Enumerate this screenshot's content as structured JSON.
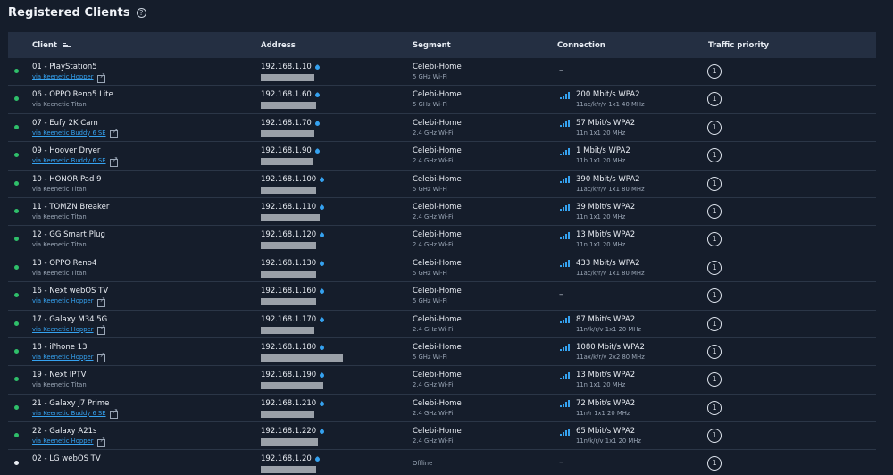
{
  "page": {
    "title": "Registered Clients",
    "help_icon": "?"
  },
  "columns": {
    "client": "Client",
    "address": "Address",
    "segment": "Segment",
    "connection": "Connection",
    "traffic_priority": "Traffic priority"
  },
  "clients": [
    {
      "status": "online",
      "name": "01 - PlayStation5",
      "via": "via Keenetic Hopper",
      "via_link": true,
      "ip": "192.168.1.10",
      "mac_width": 60,
      "segment": "Celebi-Home",
      "band": "5 GHz Wi-Fi",
      "connection": "",
      "conn_detail": "",
      "signal_bars": 0,
      "priority": "1",
      "dash": "–"
    },
    {
      "status": "online",
      "name": "06 - OPPO Reno5 Lite",
      "via": "via Keenetic Titan",
      "via_link": false,
      "ip": "192.168.1.60",
      "mac_width": 62,
      "segment": "Celebi-Home",
      "band": "5 GHz Wi-Fi",
      "connection": "200 Mbit/s  WPA2",
      "conn_detail": "11ac/k/r/v 1x1 40 MHz",
      "signal_bars": 4,
      "priority": "1",
      "dash": ""
    },
    {
      "status": "online",
      "name": "07 - Eufy 2K Cam",
      "via": "via Keenetic Buddy 6 SE",
      "via_link": true,
      "ip": "192.168.1.70",
      "mac_width": 60,
      "segment": "Celebi-Home",
      "band": "2.4 GHz Wi-Fi",
      "connection": "57 Mbit/s  WPA2",
      "conn_detail": "11n 1x1 20 MHz",
      "signal_bars": 4,
      "priority": "1",
      "dash": ""
    },
    {
      "status": "online",
      "name": "09 - Hoover Dryer",
      "via": "via Keenetic Buddy 6 SE",
      "via_link": true,
      "ip": "192.168.1.90",
      "mac_width": 58,
      "segment": "Celebi-Home",
      "band": "2.4 GHz Wi-Fi",
      "connection": "1 Mbit/s  WPA2",
      "conn_detail": "11b 1x1 20 MHz",
      "signal_bars": 4,
      "priority": "1",
      "dash": ""
    },
    {
      "status": "online",
      "name": "10 - HONOR Pad 9",
      "via": "via Keenetic Titan",
      "via_link": false,
      "ip": "192.168.1.100",
      "mac_width": 62,
      "segment": "Celebi-Home",
      "band": "5 GHz Wi-Fi",
      "connection": "390 Mbit/s  WPA2",
      "conn_detail": "11ac/k/r/v 1x1 80 MHz",
      "signal_bars": 4,
      "priority": "1",
      "dash": ""
    },
    {
      "status": "online",
      "name": "11 - TOMZN Breaker",
      "via": "via Keenetic Titan",
      "via_link": false,
      "ip": "192.168.1.110",
      "mac_width": 66,
      "segment": "Celebi-Home",
      "band": "2.4 GHz Wi-Fi",
      "connection": "39 Mbit/s  WPA2",
      "conn_detail": "11n 1x1 20 MHz",
      "signal_bars": 4,
      "priority": "1",
      "dash": ""
    },
    {
      "status": "online",
      "name": "12 - GG Smart Plug",
      "via": "via Keenetic Titan",
      "via_link": false,
      "ip": "192.168.1.120",
      "mac_width": 62,
      "segment": "Celebi-Home",
      "band": "2.4 GHz Wi-Fi",
      "connection": "13 Mbit/s  WPA2",
      "conn_detail": "11n 1x1 20 MHz",
      "signal_bars": 4,
      "priority": "1",
      "dash": ""
    },
    {
      "status": "online",
      "name": "13 - OPPO Reno4",
      "via": "via Keenetic Titan",
      "via_link": false,
      "ip": "192.168.1.130",
      "mac_width": 62,
      "segment": "Celebi-Home",
      "band": "5 GHz Wi-Fi",
      "connection": "433 Mbit/s  WPA2",
      "conn_detail": "11ac/k/r/v 1x1 80 MHz",
      "signal_bars": 4,
      "priority": "1",
      "dash": ""
    },
    {
      "status": "online",
      "name": "16 - Next webOS TV",
      "via": "via Keenetic Hopper",
      "via_link": true,
      "ip": "192.168.1.160",
      "mac_width": 62,
      "segment": "Celebi-Home",
      "band": "5 GHz Wi-Fi",
      "connection": "",
      "conn_detail": "",
      "signal_bars": 0,
      "priority": "1",
      "dash": "–"
    },
    {
      "status": "online",
      "name": "17 - Galaxy M34 5G",
      "via": "via Keenetic Hopper",
      "via_link": true,
      "ip": "192.168.1.170",
      "mac_width": 60,
      "segment": "Celebi-Home",
      "band": "2.4 GHz Wi-Fi",
      "connection": "87 Mbit/s  WPA2",
      "conn_detail": "11n/k/r/v 1x1 20 MHz",
      "signal_bars": 4,
      "priority": "1",
      "dash": ""
    },
    {
      "status": "online",
      "name": "18 - iPhone 13",
      "via": "via Keenetic Hopper",
      "via_link": true,
      "ip": "192.168.1.180",
      "mac_width": 92,
      "segment": "Celebi-Home",
      "band": "5 GHz Wi-Fi",
      "connection": "1080 Mbit/s  WPA2",
      "conn_detail": "11ax/k/r/v 2x2 80 MHz",
      "signal_bars": 4,
      "priority": "1",
      "dash": ""
    },
    {
      "status": "online",
      "name": "19 - Next IPTV",
      "via": "via Keenetic Titan",
      "via_link": false,
      "ip": "192.168.1.190",
      "mac_width": 70,
      "segment": "Celebi-Home",
      "band": "2.4 GHz Wi-Fi",
      "connection": "13 Mbit/s  WPA2",
      "conn_detail": "11n 1x1 20 MHz",
      "signal_bars": 4,
      "priority": "1",
      "dash": ""
    },
    {
      "status": "online",
      "name": "21 - Galaxy J7 Prime",
      "via": "via Keenetic Buddy 6 SE",
      "via_link": true,
      "ip": "192.168.1.210",
      "mac_width": 60,
      "segment": "Celebi-Home",
      "band": "2.4 GHz Wi-Fi",
      "connection": "72 Mbit/s  WPA2",
      "conn_detail": "11n/r 1x1 20 MHz",
      "signal_bars": 4,
      "priority": "1",
      "dash": ""
    },
    {
      "status": "online",
      "name": "22 - Galaxy A21s",
      "via": "via Keenetic Hopper",
      "via_link": true,
      "ip": "192.168.1.220",
      "mac_width": 64,
      "segment": "Celebi-Home",
      "band": "2.4 GHz Wi-Fi",
      "connection": "65 Mbit/s  WPA2",
      "conn_detail": "11n/k/r/v 1x1 20 MHz",
      "signal_bars": 4,
      "priority": "1",
      "dash": ""
    },
    {
      "status": "offline",
      "name": "02 - LG webOS TV",
      "via": "",
      "via_link": false,
      "ip": "192.168.1.20",
      "mac_width": 62,
      "segment": "Offline",
      "band": "",
      "connection": "",
      "conn_detail": "",
      "signal_bars": 0,
      "priority": "1",
      "dash": "–"
    }
  ]
}
